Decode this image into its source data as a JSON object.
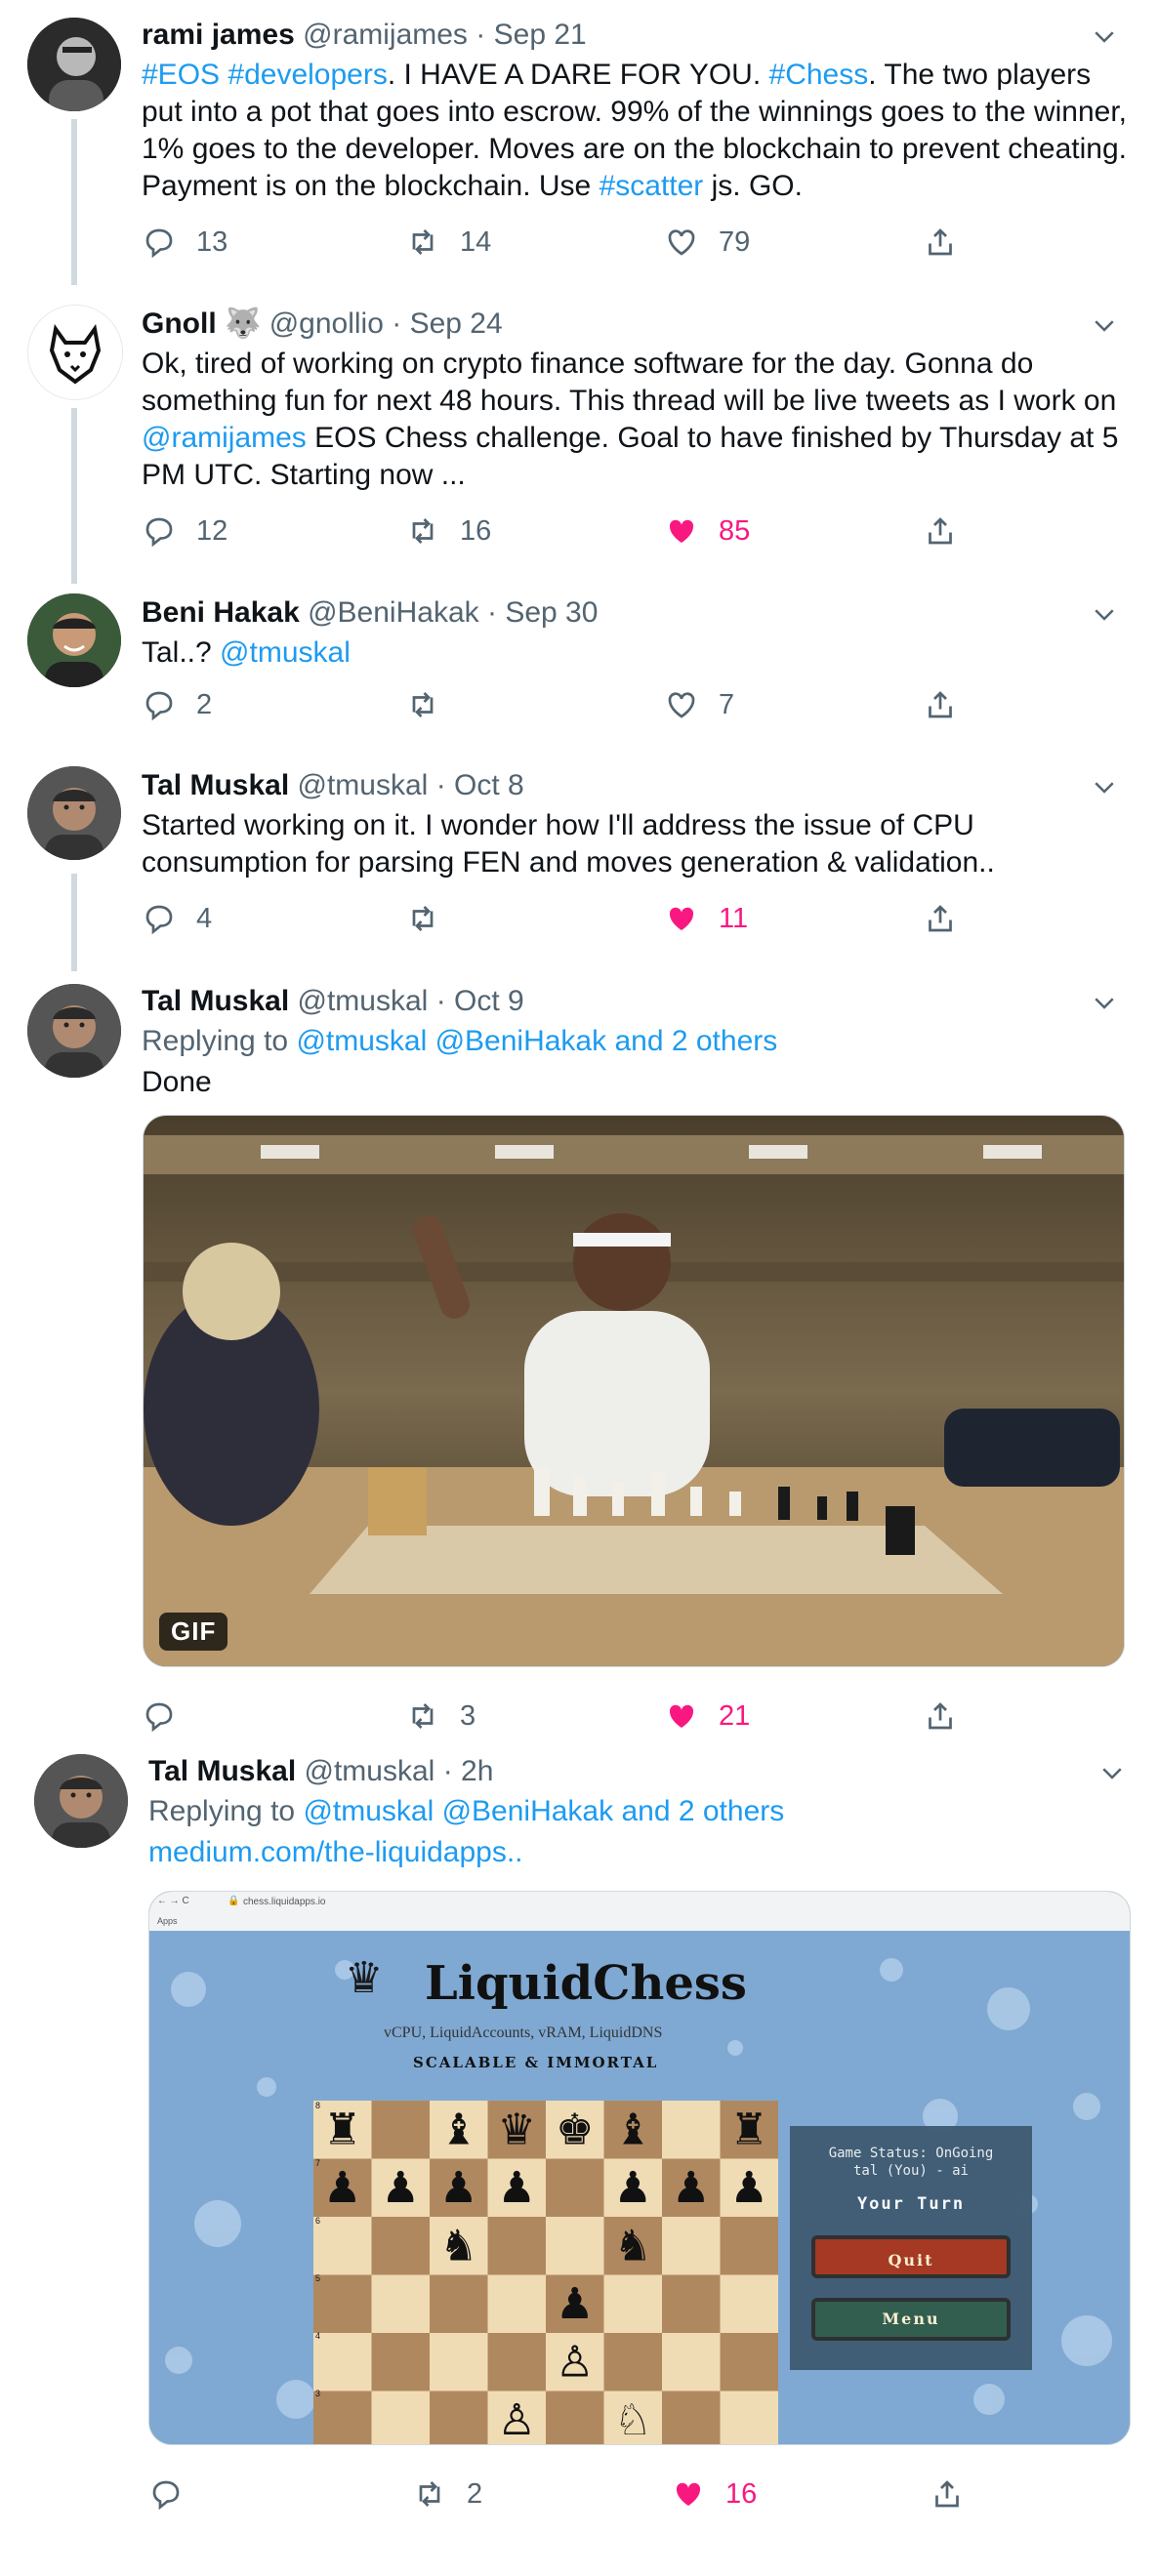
{
  "colors": {
    "link": "#1d9bf0",
    "muted": "#536471",
    "like_active": "#f91880",
    "thread_line": "#cfd9de"
  },
  "tweets": [
    {
      "name": "rami james",
      "handle": "@ramijames",
      "date": "Sep 21",
      "text_parts": [
        "#EOS",
        "#developers",
        ". I HAVE A DARE FOR YOU. ",
        "#Chess",
        ". The two players put into a pot that goes into escrow. 99% of the winnings goes to the winner, 1% goes to the developer. Moves are on the blockchain to prevent cheating. Payment is on the blockchain. Use ",
        "#scatter",
        " js. GO."
      ],
      "replies": "13",
      "retweets": "14",
      "likes": "79",
      "liked": false
    },
    {
      "name": "Gnoll",
      "badge": "🐺",
      "handle": "@gnollio",
      "date": "Sep 24",
      "text_parts": [
        "Ok, tired of working on crypto finance software for the day. Gonna do something fun for next 48 hours. This thread will be live tweets as I work on ",
        "@ramijames",
        " EOS Chess challenge. Goal to have finished by Thursday at 5 PM UTC. Starting now ..."
      ],
      "replies": "12",
      "retweets": "16",
      "likes": "85",
      "liked": true
    },
    {
      "name": "Beni Hakak",
      "handle": "@BeniHakak",
      "date": "Sep 30",
      "text_parts": [
        "Tal..? ",
        "@tmuskal"
      ],
      "replies": "2",
      "retweets": "",
      "likes": "7",
      "liked": false
    },
    {
      "name": "Tal Muskal",
      "handle": "@tmuskal",
      "date": "Oct 8",
      "text_parts": [
        "Started working on it. I wonder how I'll address the issue of CPU consumption for parsing FEN and moves generation & validation.."
      ],
      "replies": "4",
      "retweets": "",
      "likes": "11",
      "liked": true
    },
    {
      "name": "Tal Muskal",
      "handle": "@tmuskal",
      "date": "Oct 9",
      "replying_label": "Replying to ",
      "replying_to": "@tmuskal @BeniHakak and 2 others",
      "text": "Done",
      "gif_badge": "GIF",
      "replies": "",
      "retweets": "3",
      "likes": "21",
      "liked": true
    },
    {
      "name": "Tal Muskal",
      "handle": "@tmuskal",
      "date": "2h",
      "replying_label": "Replying to ",
      "replying_to": "@tmuskal @BeniHakak and 2 others",
      "link": "medium.com/the-liquidapps..",
      "replies": "",
      "retweets": "2",
      "likes": "16",
      "liked": true
    }
  ],
  "screenshot": {
    "url": "chess.liquidapps.io",
    "apps": "Apps",
    "logo": "LiquidChess",
    "tagline": "vCPU, LiquidAccounts, vRAM, LiquidDNS",
    "subtitle": "SCALABLE & IMMORTAL",
    "status": "Game Status: OnGoing",
    "players": "tal (You) - ai",
    "turn": "Your Turn",
    "quit": "Quit",
    "menu": "Menu",
    "ranks": [
      "8",
      "7",
      "6",
      "5",
      "4",
      "3"
    ]
  }
}
